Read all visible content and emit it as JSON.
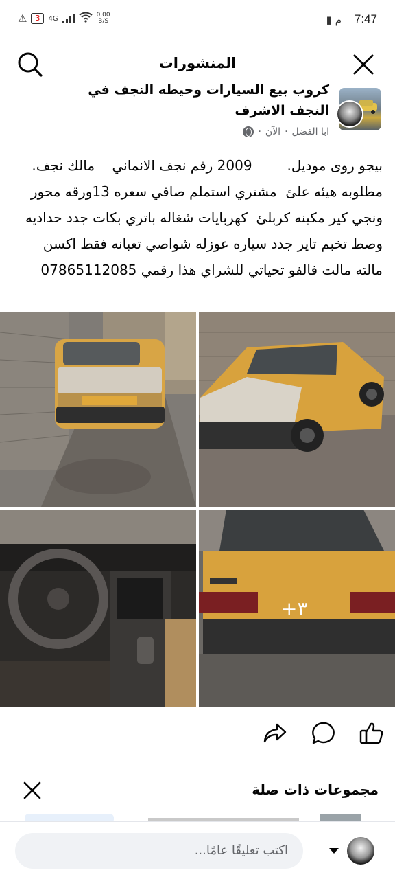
{
  "status_bar": {
    "time": "7:47",
    "am_pm": "م",
    "battery": "3",
    "network": "4G",
    "speed_value": "0,00",
    "speed_unit": "B/S"
  },
  "header": {
    "title": "المنشورات"
  },
  "post": {
    "group_name": "كروب بيع السيارات وحيطه النجف في النجف الاشرف",
    "author": "ابا الفضل",
    "time": "الآن",
    "text": "بيجو روى موديل.        2009 رقم نجف الانماني    مالك نجف.      مطلوبه هيئه علئ  مشتري استملم صافي سعره 13ورقه محور ونجي كير مكينه كربلئ  كهربايات شغاله باتري بكات جدد حداديه وصط تخبم تاير جدد سياره عوزله شواصي تعبانه فقط اكسن مالته مالت فالفو تحياتي للشراي هذا رقمي 07865112085",
    "plate_text": "+٣"
  },
  "related": {
    "title": "مجموعات ذات صلة"
  },
  "comment": {
    "placeholder": "اكتب تعليقًا عامًا..."
  },
  "colors": {
    "icon": "#050505",
    "secondary_text": "#65676b",
    "input_bg": "#f0f2f5",
    "taxi_yellow": "#d9a441"
  }
}
